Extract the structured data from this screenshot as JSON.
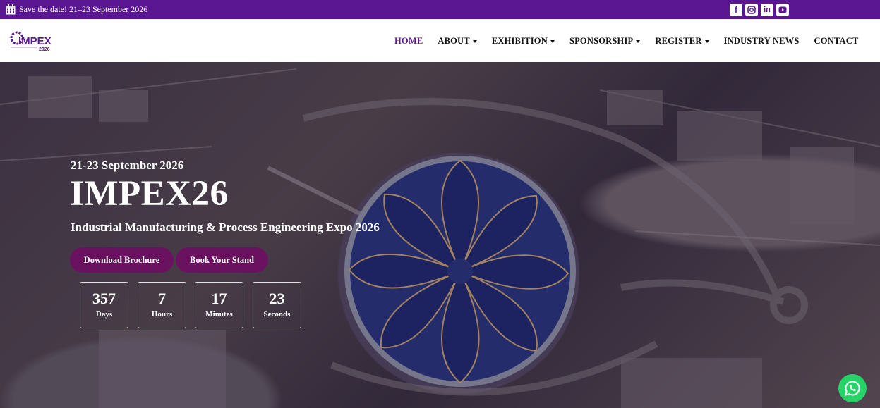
{
  "topbar": {
    "save_text": "Save the date! 21–23 September 2026",
    "icons": [
      "calendar-icon",
      "facebook-icon",
      "instagram-icon",
      "linkedin-icon",
      "youtube-icon"
    ],
    "background": "#5b1791"
  },
  "logo": {
    "text": "IMPEX",
    "year": "2026"
  },
  "nav": {
    "items": [
      {
        "label": "HOME",
        "dropdown": false,
        "active": true
      },
      {
        "label": "ABOUT",
        "dropdown": true
      },
      {
        "label": "EXHIBITION",
        "dropdown": true
      },
      {
        "label": "SPONSORSHIP",
        "dropdown": true
      },
      {
        "label": "REGISTER",
        "dropdown": true
      },
      {
        "label": "INDUSTRY NEWS",
        "dropdown": false
      },
      {
        "label": "CONTACT",
        "dropdown": false
      }
    ],
    "active_color": "#5b1791"
  },
  "hero": {
    "date": "21-23 September 2026",
    "title": "IMPEX26",
    "subtitle": "Industrial Manufacturing & Process Engineering Expo 2026",
    "buttons": {
      "download": "Download Brochure",
      "book": "Book Your Stand"
    },
    "button_color": "#6a1260"
  },
  "countdown": [
    {
      "value": "357",
      "label": "Days"
    },
    {
      "value": "7",
      "label": "Hours"
    },
    {
      "value": "17",
      "label": "Minutes"
    },
    {
      "value": "23",
      "label": "Seconds"
    }
  ],
  "whatsapp": {
    "icon": "whatsapp-icon",
    "color": "#25d366"
  }
}
